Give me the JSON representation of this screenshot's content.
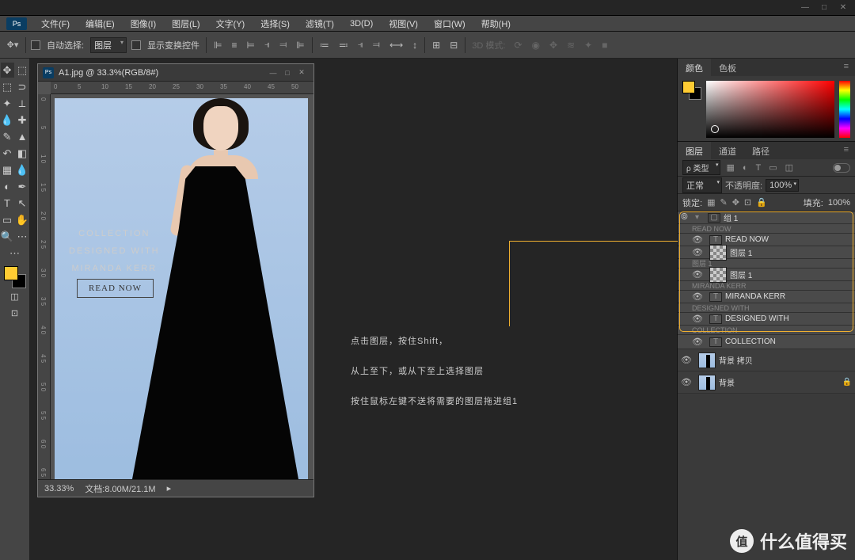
{
  "title": {
    "min": "—",
    "max": "□",
    "close": "✕"
  },
  "menu": {
    "logo": "Ps",
    "items": [
      "文件(F)",
      "编辑(E)",
      "图像(I)",
      "图层(L)",
      "文字(Y)",
      "选择(S)",
      "滤镜(T)",
      "3D(D)",
      "视图(V)",
      "窗口(W)",
      "帮助(H)"
    ]
  },
  "options": {
    "auto_select": "自动选择:",
    "layer_select": "图层",
    "show_transform": "显示变换控件",
    "mode_3d": "3D 模式:"
  },
  "document": {
    "filename": "A1.jpg @ 33.3%(RGB/8#)",
    "zoom": "33.33%",
    "docinfo": "文档:8.00M/21.1M",
    "ruler_h": [
      "0",
      "5",
      "10",
      "15",
      "20",
      "25",
      "30",
      "35",
      "40",
      "45",
      "50"
    ],
    "ruler_v": [
      "0",
      "5",
      "1 0",
      "1 5",
      "2 0",
      "2 5",
      "3 0",
      "3 5",
      "4 0",
      "4 5",
      "5 0",
      "5 5",
      "6 0",
      "6 5"
    ],
    "canvas_text": {
      "line1": "COLLECTION",
      "line2": "DESIGNED WITH",
      "line3": "MIRANDA KERR",
      "button": "READ NOW"
    }
  },
  "annotation": {
    "line1": "点击图层，按住Shift，",
    "line2": "从上至下，或从下至上选择图层",
    "line3": "按住鼠标左键不送将需要的图层拖进组1"
  },
  "panels": {
    "color": {
      "tab1": "颜色",
      "tab2": "色板"
    },
    "layers": {
      "tab1": "图层",
      "tab2": "通道",
      "tab3": "路径",
      "filter_type": "ρ 类型",
      "blend": "正常",
      "opacity_lbl": "不透明度:",
      "opacity_val": "100%",
      "lock_lbl": "锁定:",
      "fill_lbl": "填充:",
      "fill_val": "100%",
      "items": [
        {
          "name": "组 1",
          "sub": "READ NOW",
          "type": "group"
        },
        {
          "name": "READ NOW",
          "type": "text"
        },
        {
          "name": "图层 1",
          "sub": "图层 1",
          "type": "raster"
        },
        {
          "name": "图层 1",
          "sub": "MIRANDA KERR",
          "type": "raster"
        },
        {
          "name": "MIRANDA KERR",
          "sub": "DESIGNED WITH",
          "type": "text"
        },
        {
          "name": "DESIGNED WITH",
          "sub": "COLLECTION",
          "type": "text"
        },
        {
          "name": "COLLECTION",
          "type": "text"
        },
        {
          "name": "背景 拷贝",
          "type": "image"
        },
        {
          "name": "背景",
          "type": "image",
          "locked": true
        }
      ]
    }
  },
  "watermark": {
    "badge": "值",
    "text": "什么值得买"
  }
}
